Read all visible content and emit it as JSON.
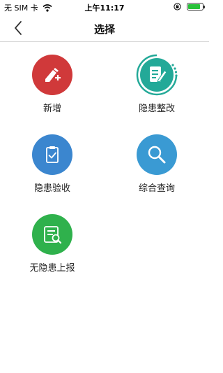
{
  "status_bar": {
    "carrier": "无 SIM 卡",
    "time": "上午11:17",
    "battery_level": 0.85,
    "battery_color": "#29c23a"
  },
  "nav": {
    "title": "选择",
    "back_icon": "chevron-left-icon"
  },
  "menu": {
    "items": [
      {
        "label": "新增",
        "icon": "edit-plus-icon",
        "color": "#d0393a"
      },
      {
        "label": "隐患整改",
        "icon": "edit-document-icon",
        "color": "#23a998"
      },
      {
        "label": "隐患验收",
        "icon": "clipboard-check-icon",
        "color": "#3b86cf"
      },
      {
        "label": "综合查询",
        "icon": "search-icon",
        "color": "#3a9ad3"
      },
      {
        "label": "无隐患上报",
        "icon": "report-search-icon",
        "color": "#2fb14c"
      }
    ]
  }
}
